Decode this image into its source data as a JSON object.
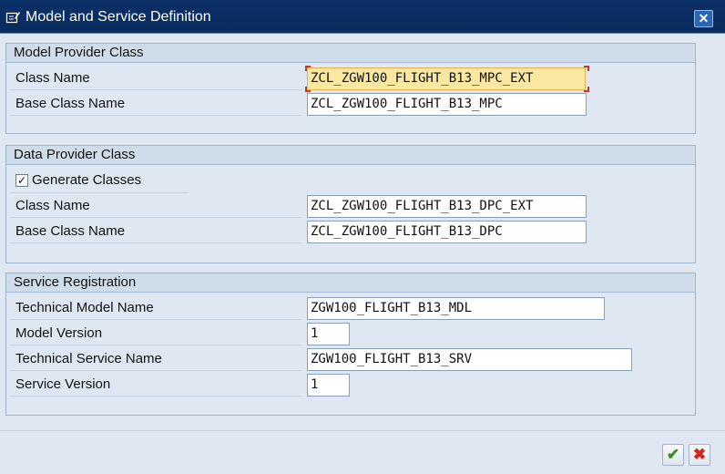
{
  "window": {
    "title": "Model and Service Definition",
    "close_glyph": "✕"
  },
  "model_provider": {
    "header": "Model Provider Class",
    "class_name_label": "Class Name",
    "class_name_value": "ZCL_ZGW100_FLIGHT_B13_MPC_EXT",
    "base_class_label": "Base Class Name",
    "base_class_value": "ZCL_ZGW100_FLIGHT_B13_MPC"
  },
  "data_provider": {
    "header": "Data Provider Class",
    "generate_label": "Generate Classes",
    "generate_checked": true,
    "check_glyph": "✓",
    "class_name_label": "Class Name",
    "class_name_value": "ZCL_ZGW100_FLIGHT_B13_DPC_EXT",
    "base_class_label": "Base Class Name",
    "base_class_value": "ZCL_ZGW100_FLIGHT_B13_DPC"
  },
  "service_registration": {
    "header": "Service Registration",
    "tech_model_label": "Technical Model Name",
    "tech_model_value": "ZGW100_FLIGHT_B13_MDL",
    "model_version_label": "Model Version",
    "model_version_value": "1",
    "tech_service_label": "Technical Service Name",
    "tech_service_value": "ZGW100_FLIGHT_B13_SRV",
    "service_version_label": "Service Version",
    "service_version_value": "1"
  },
  "footer": {
    "confirm_glyph": "✔",
    "cancel_glyph": "✖"
  },
  "colors": {
    "titlebar": "#0c3168",
    "background": "#dfe8f2",
    "focus_field": "#fbe8a0",
    "confirm": "#3e8e1a",
    "cancel": "#d0281d"
  }
}
